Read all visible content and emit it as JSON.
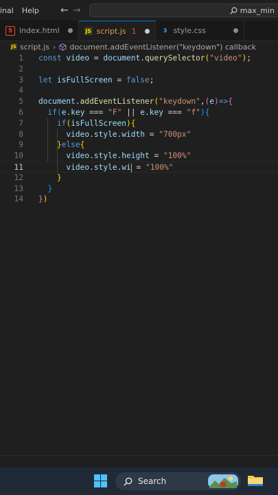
{
  "menu": {
    "items": [
      "inal",
      "Help"
    ]
  },
  "search": {
    "text": "max_min"
  },
  "tabs": [
    {
      "name": "index.html",
      "icon": "html5-icon",
      "modified": true
    },
    {
      "name": "script.js",
      "icon": "js-icon",
      "problems": "1",
      "modified": true
    },
    {
      "name": "style.css",
      "icon": "css3-icon",
      "modified": true
    }
  ],
  "breadcrumb": {
    "file": "script.js",
    "symbol": "document.addEventListener(\"keydown\") callback"
  },
  "editor": {
    "current_line": "11",
    "line_numbers": [
      "1",
      "2",
      "3",
      "4",
      "5",
      "6",
      "7",
      "8",
      "9",
      "10",
      "11",
      "12",
      "13",
      "14"
    ],
    "lines": [
      [
        [
          "kw",
          "const "
        ],
        [
          "var",
          "video"
        ],
        [
          "pl",
          " = "
        ],
        [
          "var",
          "document"
        ],
        [
          "pl",
          "."
        ],
        [
          "fn",
          "querySelector"
        ],
        [
          "br1",
          "("
        ],
        [
          "str",
          "\"video\""
        ],
        [
          "br1",
          ")"
        ],
        [
          "pl",
          ";"
        ]
      ],
      [],
      [
        [
          "kw",
          "let "
        ],
        [
          "var",
          "isFullScreen"
        ],
        [
          "pl",
          " = "
        ],
        [
          "kw",
          "false"
        ],
        [
          "pl",
          ";"
        ]
      ],
      [],
      [
        [
          "var",
          "document"
        ],
        [
          "pl",
          "."
        ],
        [
          "fn",
          "addEventListener"
        ],
        [
          "br1",
          "("
        ],
        [
          "str",
          "\"keydown\""
        ],
        [
          "pl",
          ","
        ],
        [
          "br2",
          "("
        ],
        [
          "var",
          "e"
        ],
        [
          "br2",
          ")"
        ],
        [
          "kw",
          "=>"
        ],
        [
          "br2",
          "{"
        ]
      ],
      [
        [
          "pl",
          "  "
        ],
        [
          "kw",
          "if"
        ],
        [
          "br3",
          "("
        ],
        [
          "var",
          "e"
        ],
        [
          "pl",
          "."
        ],
        [
          "var",
          "key"
        ],
        [
          "pl",
          " === "
        ],
        [
          "str",
          "\"F\""
        ],
        [
          "pl",
          " || "
        ],
        [
          "var",
          "e"
        ],
        [
          "pl",
          "."
        ],
        [
          "var",
          "key"
        ],
        [
          "pl",
          " === "
        ],
        [
          "str",
          "\"f\""
        ],
        [
          "br3",
          ")"
        ],
        [
          "br3",
          "{"
        ]
      ],
      [
        [
          "pl",
          "    "
        ],
        [
          "kw",
          "if"
        ],
        [
          "br1",
          "("
        ],
        [
          "var",
          "isFullScreen"
        ],
        [
          "br1",
          ")"
        ],
        [
          "br1",
          "{"
        ]
      ],
      [
        [
          "pl",
          "      "
        ],
        [
          "var",
          "video"
        ],
        [
          "pl",
          "."
        ],
        [
          "var",
          "style"
        ],
        [
          "pl",
          "."
        ],
        [
          "var",
          "width"
        ],
        [
          "pl",
          " = "
        ],
        [
          "str",
          "\"700px\""
        ]
      ],
      [
        [
          "pl",
          "    "
        ],
        [
          "br1",
          "}"
        ],
        [
          "kw",
          "else"
        ],
        [
          "br1",
          "{"
        ]
      ],
      [
        [
          "pl",
          "      "
        ],
        [
          "var",
          "video"
        ],
        [
          "pl",
          "."
        ],
        [
          "var",
          "style"
        ],
        [
          "pl",
          "."
        ],
        [
          "var",
          "height"
        ],
        [
          "pl",
          " = "
        ],
        [
          "str",
          "\"100%\""
        ]
      ],
      [
        [
          "pl",
          "      "
        ],
        [
          "var",
          "video"
        ],
        [
          "pl",
          "."
        ],
        [
          "var",
          "style"
        ],
        [
          "pl",
          "."
        ],
        [
          "var",
          "wi"
        ],
        [
          "cursor",
          ""
        ],
        [
          "pl",
          " = "
        ],
        [
          "str",
          "\"100%\""
        ]
      ],
      [
        [
          "pl",
          "    "
        ],
        [
          "br1",
          "}"
        ]
      ],
      [
        [
          "pl",
          "  "
        ],
        [
          "br3",
          "}"
        ]
      ],
      [
        [
          "br2",
          "}"
        ],
        [
          "br1",
          ")"
        ]
      ]
    ]
  },
  "taskbar": {
    "search_label": "Search"
  },
  "colors": {
    "accent": "#0078d4",
    "js_tab": "#e0a050",
    "error": "#f14c4c"
  }
}
